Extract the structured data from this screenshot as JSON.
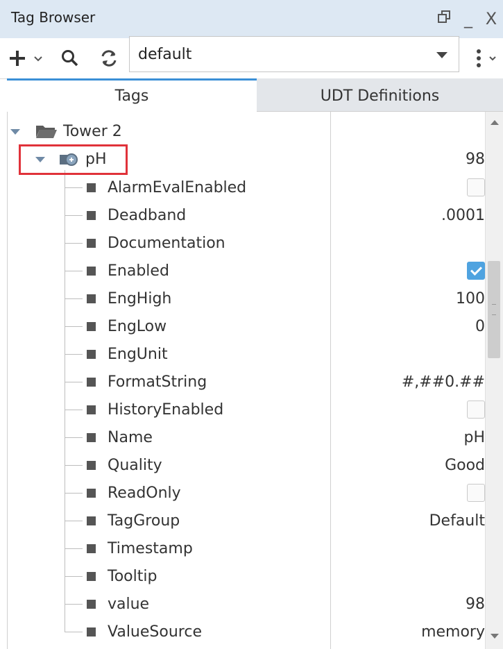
{
  "window": {
    "title": "Tag Browser",
    "controls": {
      "restore_icon": "restore-icon",
      "minimize": "_",
      "close": "X"
    }
  },
  "toolbar": {
    "add_icon": "plus-icon",
    "search_icon": "search-icon",
    "refresh_icon": "refresh-icon",
    "provider_value": "default",
    "more_icon": "kebab-menu-icon"
  },
  "tabs": [
    {
      "label": "Tags",
      "active": true
    },
    {
      "label": "UDT Definitions",
      "active": false
    }
  ],
  "tree": {
    "folder": {
      "label": "Tower 2",
      "icon": "folder-open-icon"
    },
    "tag": {
      "label": "pH",
      "value": "98",
      "icon": "memory-tag-icon",
      "highlighted": true
    },
    "properties": [
      {
        "label": "AlarmEvalEnabled",
        "type": "checkbox",
        "checked": false
      },
      {
        "label": "Deadband",
        "type": "text",
        "value": ".0001"
      },
      {
        "label": "Documentation",
        "type": "text",
        "value": ""
      },
      {
        "label": "Enabled",
        "type": "checkbox",
        "checked": true
      },
      {
        "label": "EngHigh",
        "type": "text",
        "value": "100"
      },
      {
        "label": "EngLow",
        "type": "text",
        "value": "0"
      },
      {
        "label": "EngUnit",
        "type": "text",
        "value": ""
      },
      {
        "label": "FormatString",
        "type": "text",
        "value": "#,##0.##"
      },
      {
        "label": "HistoryEnabled",
        "type": "checkbox",
        "checked": false
      },
      {
        "label": "Name",
        "type": "text",
        "value": "pH"
      },
      {
        "label": "Quality",
        "type": "text",
        "value": "Good"
      },
      {
        "label": "ReadOnly",
        "type": "checkbox",
        "checked": false
      },
      {
        "label": "TagGroup",
        "type": "text",
        "value": "Default"
      },
      {
        "label": "Timestamp",
        "type": "text",
        "value": ""
      },
      {
        "label": "Tooltip",
        "type": "text",
        "value": ""
      },
      {
        "label": "value",
        "type": "text",
        "value": "98"
      },
      {
        "label": "ValueSource",
        "type": "text",
        "value": "memory"
      }
    ]
  },
  "colors": {
    "titlebar": "#dde8f3",
    "active_tab_accent": "#3b8fd6",
    "highlight": "#e0323a",
    "checkbox_checked": "#4fa3e0"
  }
}
